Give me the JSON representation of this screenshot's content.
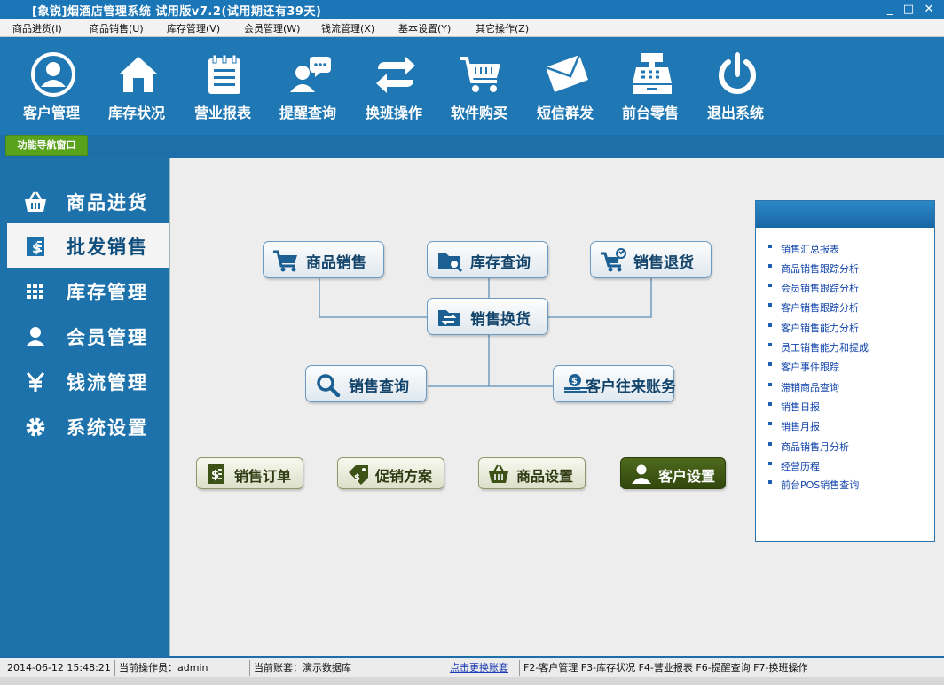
{
  "window": {
    "title": "[象锐]烟酒店管理系统 试用版v7.2(试用期还有39天)",
    "minimize": "_",
    "maximize": "□",
    "close": "✕"
  },
  "menu": [
    "商品进货(I)",
    "商品销售(U)",
    "库存管理(V)",
    "会员管理(W)",
    "钱流管理(X)",
    "基本设置(Y)",
    "其它操作(Z)"
  ],
  "toolbar": [
    {
      "label": "客户管理",
      "icon": "customer-icon"
    },
    {
      "label": "库存状况",
      "icon": "home-icon"
    },
    {
      "label": "营业报表",
      "icon": "notepad-icon"
    },
    {
      "label": "提醒查询",
      "icon": "chat-user-icon"
    },
    {
      "label": "换班操作",
      "icon": "swap-arrows-icon"
    },
    {
      "label": "软件购买",
      "icon": "cart-icon"
    },
    {
      "label": "短信群发",
      "icon": "envelope-icon"
    },
    {
      "label": "前台零售",
      "icon": "cash-register-icon"
    },
    {
      "label": "退出系统",
      "icon": "power-icon"
    }
  ],
  "nav_tab": "功能导航窗口",
  "sidebar": [
    {
      "label": "商品进货",
      "icon": "basket-icon",
      "active": false
    },
    {
      "label": "批发销售",
      "icon": "invoice-icon",
      "active": true
    },
    {
      "label": "库存管理",
      "icon": "grid-icon",
      "active": false
    },
    {
      "label": "会员管理",
      "icon": "member-icon",
      "active": false
    },
    {
      "label": "钱流管理",
      "icon": "yen-icon",
      "active": false
    },
    {
      "label": "系统设置",
      "icon": "gear-icon",
      "active": false
    }
  ],
  "flow": {
    "sales": "商品销售",
    "stock_query": "库存查询",
    "sales_return": "销售退货",
    "sales_exchange": "销售换货",
    "sales_query": "销售查询",
    "customer_accounts": "客户往来账务"
  },
  "quick": {
    "sales_order": "销售订单",
    "promotion": "促销方案",
    "product_settings": "商品设置",
    "customer_settings": "客户设置"
  },
  "reports": [
    "销售汇总报表",
    "商品销售跟踪分析",
    "会员销售跟踪分析",
    "客户销售跟踪分析",
    "客户销售能力分析",
    "员工销售能力和提成",
    "客户事件跟踪",
    "滞销商品查询",
    "销售日报",
    "销售月报",
    "商品销售月分析",
    "经营历程",
    "前台POS销售查询"
  ],
  "status": {
    "datetime": "2014-06-12 15:48:21",
    "operator": "当前操作员：admin",
    "account": "当前账套：演示数据库",
    "switch_link": "点击更换账套",
    "shortcuts": "F2-客户管理 F3-库存状况 F4-营业报表 F6-提醒查询 F7-换班操作"
  },
  "colors": {
    "brand_blue": "#1f77b4",
    "nav_green": "#58a21c",
    "link_blue": "#1144aa"
  }
}
